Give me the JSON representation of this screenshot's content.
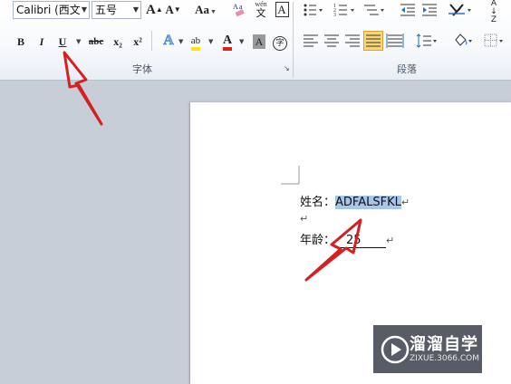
{
  "toolbar": {
    "font_name": "Calibri (西文",
    "font_size": "五号",
    "grow_font_label": "A",
    "shrink_font_label": "A",
    "change_case_label": "Aa",
    "bold_label": "B",
    "italic_label": "I",
    "underline_label": "U",
    "strike_label": "abc",
    "subscript_label": "x₂",
    "superscript_label": "x²",
    "text_effect_label": "A",
    "highlight_label": "ab",
    "font_color_label": "A",
    "char_shading_label": "A",
    "enclose_label": "字",
    "phonetic_label": "wén",
    "char_border_label": "A",
    "sort_label": "A↓Z",
    "font_group_label": "字体",
    "paragraph_group_label": "段落",
    "highlight_color": "#ffe600",
    "font_color": "#e02020"
  },
  "document": {
    "line1_label": "姓名：",
    "line1_value": "ADFALSFKL",
    "line3_label": "年龄：",
    "line3_value": "25",
    "paragraph_mark": "↵"
  },
  "watermark": {
    "title": "溜溜自学",
    "subtitle": "ZIXUE.3066.COM"
  },
  "colors": {
    "annotation_arrow": "#d42020",
    "selection_highlight": "#a9c6ea"
  }
}
